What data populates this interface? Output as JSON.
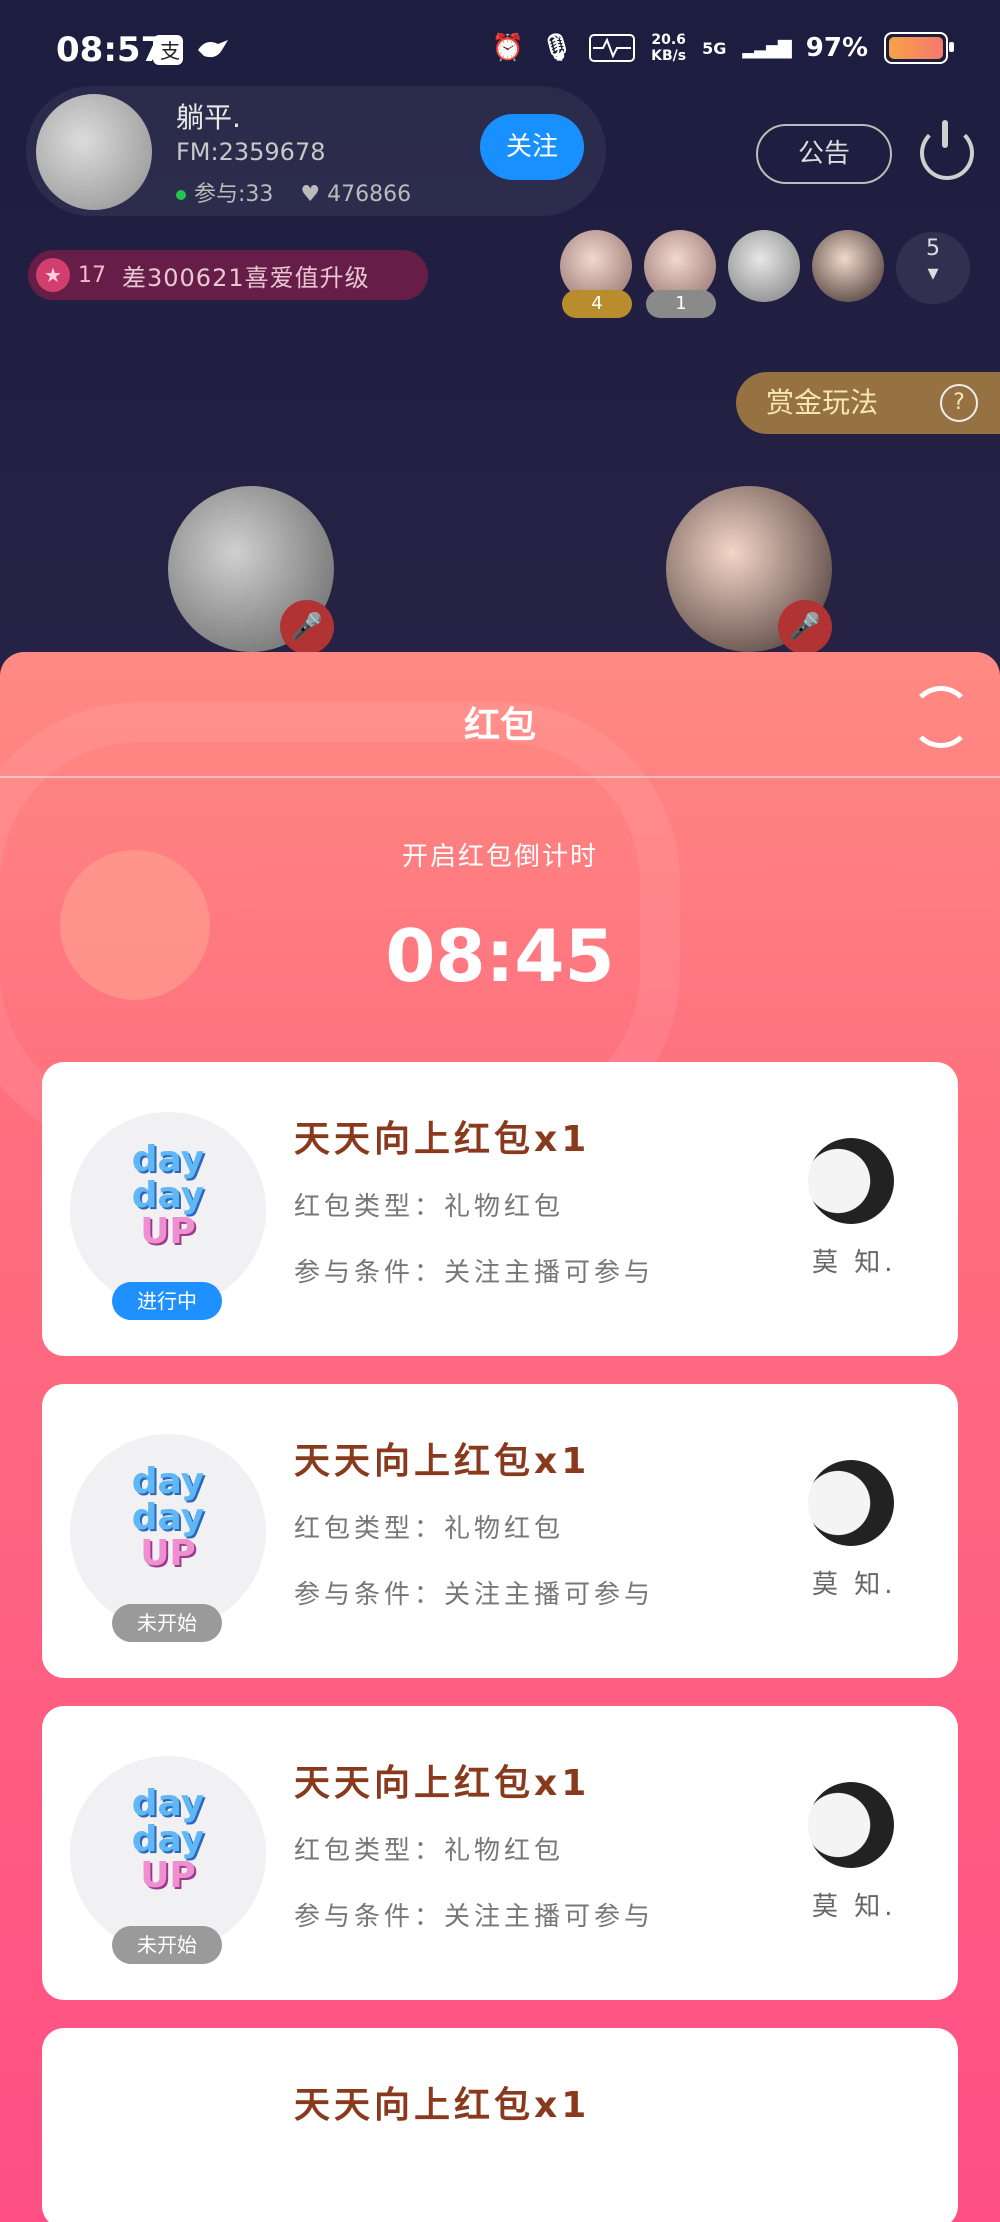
{
  "status_bar": {
    "time": "08:57",
    "net_speed": "20.6",
    "net_unit": "KB/s",
    "signal": "5G",
    "battery": "97%"
  },
  "host": {
    "name": "躺平.",
    "fm": "FM:2359678",
    "participants": "参与:33",
    "likes": "476866",
    "follow_label": "关注"
  },
  "notice_label": "公告",
  "level": {
    "number": "17",
    "text": "差300621喜爱值升级"
  },
  "viewers": {
    "badges": [
      "4",
      "1"
    ],
    "more_count": "5"
  },
  "bounty_label": "赏金玩法",
  "bounty_help": "?",
  "sheet": {
    "title": "红包",
    "countdown_label": "开启红包倒计时",
    "countdown": "08:45",
    "packets": [
      {
        "title": "天天向上红包x1",
        "type": "红包类型：礼物红包",
        "condition": "参与条件：关注主播可参与",
        "status": "进行中",
        "sender": "莫 知."
      },
      {
        "title": "天天向上红包x1",
        "type": "红包类型：礼物红包",
        "condition": "参与条件：关注主播可参与",
        "status": "未开始",
        "sender": "莫 知."
      },
      {
        "title": "天天向上红包x1",
        "type": "红包类型：礼物红包",
        "condition": "参与条件：关注主播可参与",
        "status": "未开始",
        "sender": "莫 知."
      },
      {
        "title": "天天向上红包x1"
      }
    ],
    "logo": {
      "line1": "day",
      "line2": "day",
      "line3": "UP"
    }
  },
  "colors": {
    "active_status": "#1e90ff",
    "pending_status": "#9a9a9a",
    "follow": "#1890ff"
  }
}
